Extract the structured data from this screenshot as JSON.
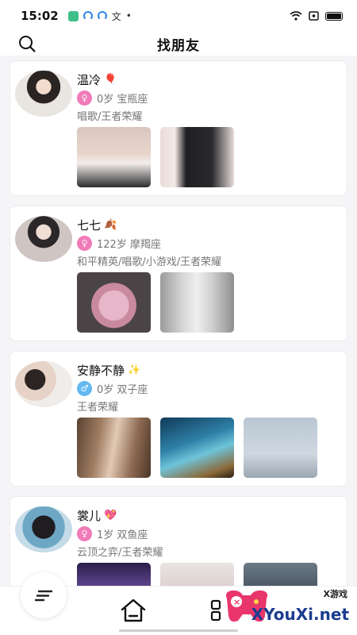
{
  "status": {
    "time": "15:02",
    "extra_glyph": "文"
  },
  "header": {
    "title": "找朋友"
  },
  "users": [
    {
      "name": "温冷",
      "emoji": "🎈",
      "gender": "female",
      "meta": "0岁 宝瓶座",
      "tags": "唱歌/王者荣耀",
      "photo_count": 2
    },
    {
      "name": "七七",
      "emoji": "🍂",
      "gender": "female",
      "meta": "122岁 摩羯座",
      "tags": "和平精英/唱歌/小游戏/王者荣耀",
      "photo_count": 2
    },
    {
      "name": "安静不静",
      "emoji": "✨",
      "gender": "male",
      "meta": "0岁 双子座",
      "tags": "王者荣耀",
      "photo_count": 3
    },
    {
      "name": "裳儿",
      "emoji": "💖",
      "gender": "female",
      "meta": "1岁 双鱼座",
      "tags": "云顶之弈/王者荣耀",
      "photo_count": 3
    }
  ],
  "watermark": {
    "top": "X游戏",
    "text": "XYouXi.net"
  }
}
